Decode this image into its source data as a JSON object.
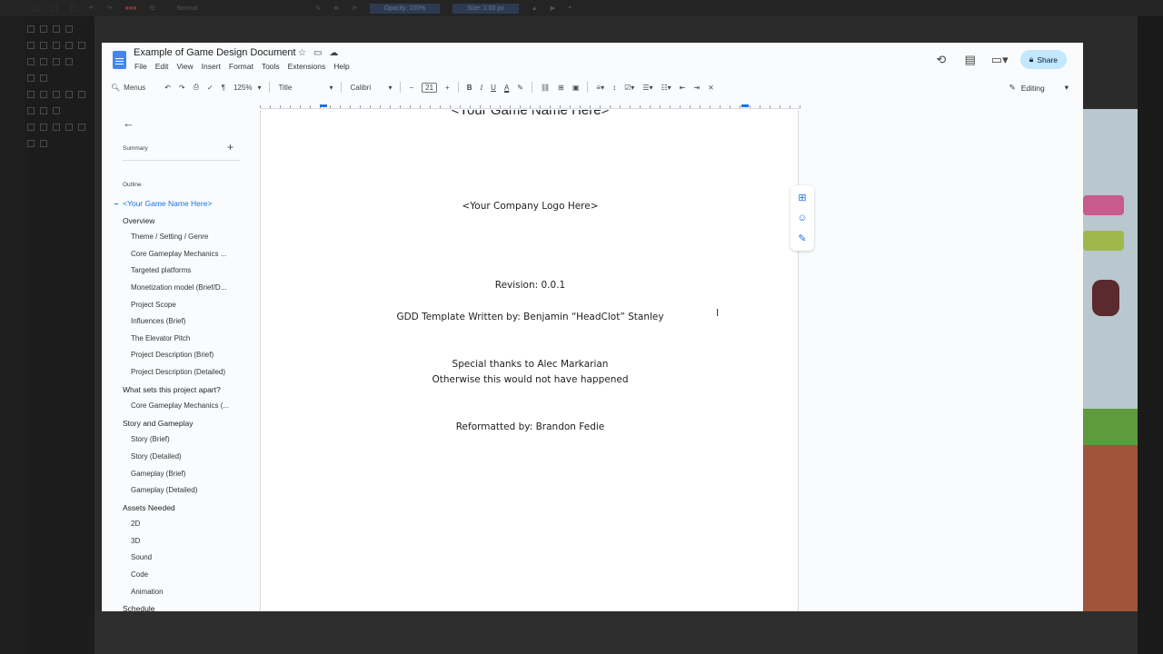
{
  "bg_app": {
    "mode": "Normal",
    "opacity": "Opacity: 100%",
    "size": "Size: 1.00 px"
  },
  "docs": {
    "title": "Example of Game Design Document",
    "menu": [
      "File",
      "Edit",
      "View",
      "Insert",
      "Format",
      "Tools",
      "Extensions",
      "Help"
    ],
    "share_label": "Share",
    "toolbar": {
      "menus_label": "Menus",
      "zoom": "125%",
      "style": "Title",
      "font": "Calibri",
      "font_size": "21",
      "editing_label": "Editing"
    },
    "outline": {
      "summary_label": "Summary",
      "outline_label": "Outline",
      "items": [
        {
          "label": "<Your Game Name Here>",
          "level": 1,
          "active": true
        },
        {
          "label": "Overview",
          "level": 1
        },
        {
          "label": "Theme / Setting / Genre",
          "level": 2
        },
        {
          "label": "Core Gameplay Mechanics ...",
          "level": 2
        },
        {
          "label": "Targeted platforms",
          "level": 2
        },
        {
          "label": "Monetization model (Brief/D...",
          "level": 2
        },
        {
          "label": "Project Scope",
          "level": 2
        },
        {
          "label": "Influences (Brief)",
          "level": 2
        },
        {
          "label": "The Elevator Pitch",
          "level": 2
        },
        {
          "label": "Project Description (Brief)",
          "level": 2
        },
        {
          "label": "Project Description (Detailed)",
          "level": 2
        },
        {
          "label": "What sets this project apart?",
          "level": 1
        },
        {
          "label": "Core Gameplay Mechanics (...",
          "level": 2
        },
        {
          "label": "Story and Gameplay",
          "level": 1
        },
        {
          "label": "Story (Brief)",
          "level": 2
        },
        {
          "label": "Story (Detailed)",
          "level": 2
        },
        {
          "label": "Gameplay (Brief)",
          "level": 2
        },
        {
          "label": "Gameplay (Detailed)",
          "level": 2
        },
        {
          "label": "Assets Needed",
          "level": 1
        },
        {
          "label": "2D",
          "level": 2
        },
        {
          "label": "3D",
          "level": 2
        },
        {
          "label": "Sound",
          "level": 2
        },
        {
          "label": "Code",
          "level": 2
        },
        {
          "label": "Animation",
          "level": 2
        },
        {
          "label": "Schedule",
          "level": 1
        }
      ]
    },
    "page": {
      "clipped_title": "<Your Game Name Here>",
      "logo_line": "<Your Company Logo Here>",
      "revision": "Revision: 0.0.1",
      "written_by": "GDD Template Written by: Benjamin “HeadClot” Stanley",
      "thanks_1": "Special thanks to Alec Markarian",
      "thanks_2": "Otherwise this would not have happened",
      "reformatted": "Reformatted by: Brandon Fedie"
    }
  }
}
